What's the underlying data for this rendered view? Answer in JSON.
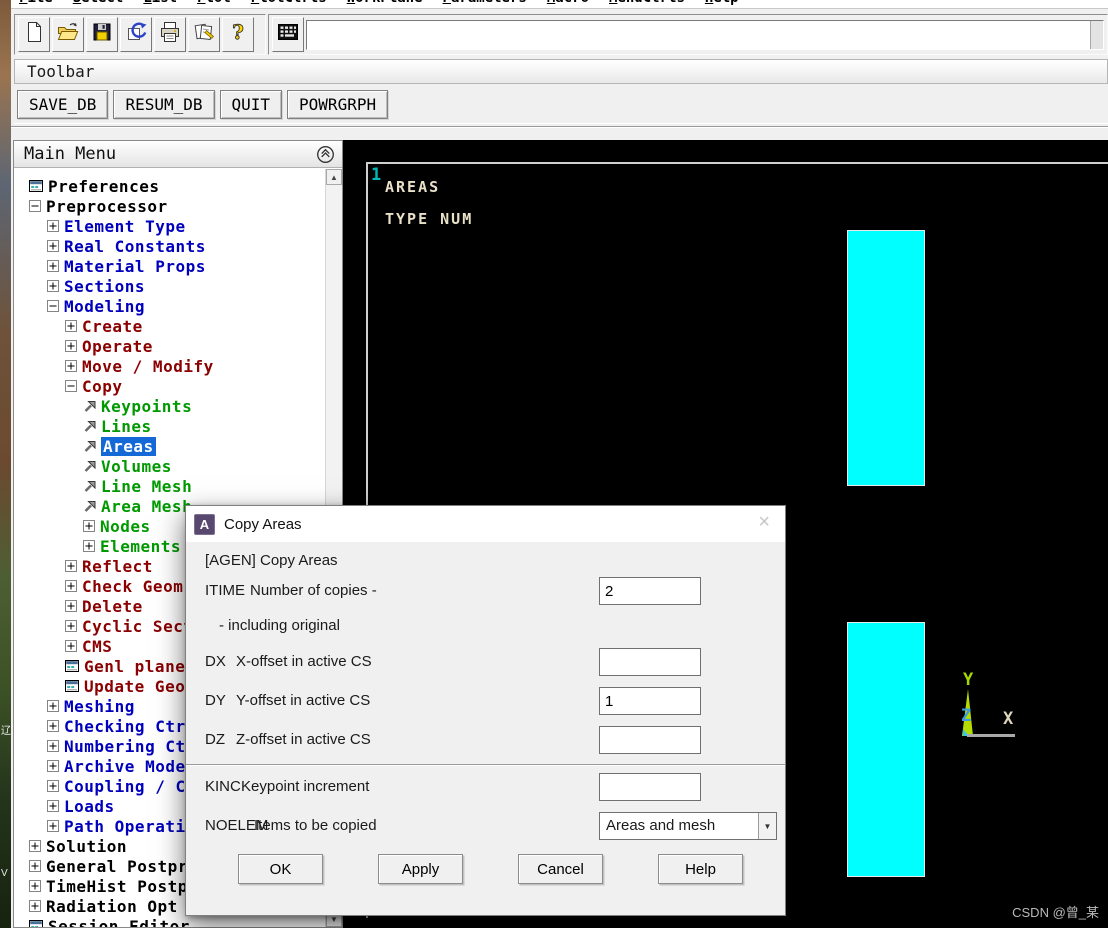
{
  "menu_bar": {
    "items": [
      "File",
      "Select",
      "List",
      "Plot",
      "PlotCtrls",
      "WorkPlane",
      "Parameters",
      "Macro",
      "MenuCtrls",
      "Help"
    ]
  },
  "quick_toolbar": {
    "icon_buttons": [
      "new-file",
      "open-folder",
      "save-db",
      "refresh-plot",
      "print",
      "report-generator",
      "help"
    ],
    "input_icon": "keypad",
    "command_input": {
      "value": ""
    }
  },
  "toolbar_panel": {
    "title": "Toolbar",
    "buttons": [
      "SAVE_DB",
      "RESUM_DB",
      "QUIT",
      "POWRGRPH"
    ]
  },
  "main_menu": {
    "title": "Main Menu",
    "collapse_icon": "chevron-up-circle",
    "items": [
      {
        "label": "Preferences",
        "level": 0,
        "icon": "dialog",
        "color": "black"
      },
      {
        "label": "Preprocessor",
        "level": 0,
        "icon": "minus",
        "color": "black"
      },
      {
        "label": "Element Type",
        "level": 1,
        "icon": "plus",
        "color": "blue"
      },
      {
        "label": "Real Constants",
        "level": 1,
        "icon": "plus",
        "color": "blue"
      },
      {
        "label": "Material Props",
        "level": 1,
        "icon": "plus",
        "color": "blue"
      },
      {
        "label": "Sections",
        "level": 1,
        "icon": "plus",
        "color": "blue"
      },
      {
        "label": "Modeling",
        "level": 1,
        "icon": "minus",
        "color": "blue"
      },
      {
        "label": "Create",
        "level": 2,
        "icon": "plus",
        "color": "red"
      },
      {
        "label": "Operate",
        "level": 2,
        "icon": "plus",
        "color": "red"
      },
      {
        "label": "Move / Modify",
        "level": 2,
        "icon": "plus",
        "color": "red"
      },
      {
        "label": "Copy",
        "level": 2,
        "icon": "minus",
        "color": "red"
      },
      {
        "label": "Keypoints",
        "level": 3,
        "icon": "arrow",
        "color": "green"
      },
      {
        "label": "Lines",
        "level": 3,
        "icon": "arrow",
        "color": "green"
      },
      {
        "label": "Areas",
        "level": 3,
        "icon": "arrow",
        "color": "green",
        "selected": true
      },
      {
        "label": "Volumes",
        "level": 3,
        "icon": "arrow",
        "color": "green"
      },
      {
        "label": "Line Mesh",
        "level": 3,
        "icon": "arrow",
        "color": "green"
      },
      {
        "label": "Area Mesh",
        "level": 3,
        "icon": "arrow",
        "color": "green"
      },
      {
        "label": "Nodes",
        "level": 3,
        "icon": "plus",
        "color": "green"
      },
      {
        "label": "Elements",
        "level": 3,
        "icon": "plus",
        "color": "green"
      },
      {
        "label": "Reflect",
        "level": 2,
        "icon": "plus",
        "color": "red"
      },
      {
        "label": "Check Geom",
        "level": 2,
        "icon": "plus",
        "color": "red"
      },
      {
        "label": "Delete",
        "level": 2,
        "icon": "plus",
        "color": "red"
      },
      {
        "label": "Cyclic Sector",
        "level": 2,
        "icon": "plus",
        "color": "red"
      },
      {
        "label": "CMS",
        "level": 2,
        "icon": "plus",
        "color": "red"
      },
      {
        "label": "Genl plane strn",
        "level": 2,
        "icon": "dialog",
        "color": "red"
      },
      {
        "label": "Update Geom",
        "level": 2,
        "icon": "dialog",
        "color": "red"
      },
      {
        "label": "Meshing",
        "level": 1,
        "icon": "plus",
        "color": "blue"
      },
      {
        "label": "Checking Ctrls",
        "level": 1,
        "icon": "plus",
        "color": "blue"
      },
      {
        "label": "Numbering Ctrls",
        "level": 1,
        "icon": "plus",
        "color": "blue"
      },
      {
        "label": "Archive Model",
        "level": 1,
        "icon": "plus",
        "color": "blue"
      },
      {
        "label": "Coupling / Ceqn",
        "level": 1,
        "icon": "plus",
        "color": "blue"
      },
      {
        "label": "Loads",
        "level": 1,
        "icon": "plus",
        "color": "blue"
      },
      {
        "label": "Path Operations",
        "level": 1,
        "icon": "plus",
        "color": "blue"
      },
      {
        "label": "Solution",
        "level": 0,
        "icon": "plus",
        "color": "black"
      },
      {
        "label": "General Postproc",
        "level": 0,
        "icon": "plus",
        "color": "black"
      },
      {
        "label": "TimeHist Postpro",
        "level": 0,
        "icon": "plus",
        "color": "black"
      },
      {
        "label": "Radiation Opt",
        "level": 0,
        "icon": "plus",
        "color": "black"
      },
      {
        "label": "Session Editor",
        "level": 0,
        "icon": "dialog",
        "color": "black"
      }
    ]
  },
  "graphics": {
    "window_id": "1",
    "annotations": [
      "AREAS",
      "TYPE NUM"
    ],
    "triad": {
      "x": "X",
      "y": "Y",
      "z": "Z"
    },
    "watermark": "CSDN @曾_某"
  },
  "dialog": {
    "title": "Copy Areas",
    "icon_letter": "A",
    "command": "[AGEN]  Copy Areas",
    "fields": [
      {
        "code": "ITIME",
        "label": "Number of copies -",
        "value": "2",
        "type": "input"
      },
      {
        "code": "",
        "label": "- including original",
        "value": "",
        "type": "note"
      },
      {
        "code": "DX",
        "label": "X-offset in active CS",
        "value": "",
        "type": "input"
      },
      {
        "code": "DY",
        "label": "Y-offset in active CS",
        "value": "1",
        "type": "input"
      },
      {
        "code": "DZ",
        "label": "Z-offset in active CS",
        "value": "",
        "type": "input"
      },
      {
        "code": "KINC",
        "label": "Keypoint increment",
        "value": "",
        "type": "input"
      },
      {
        "code": "NOELEM",
        "label": "Items to be copied",
        "value": "Areas and mesh",
        "type": "select"
      }
    ],
    "buttons": [
      "OK",
      "Apply",
      "Cancel",
      "Help"
    ]
  },
  "colors": {
    "tree_black": "#000000",
    "tree_blue": "#0000bd",
    "tree_red": "#8b0000",
    "tree_green": "#009a00",
    "selection": "#1569d6",
    "area_fill": "#00ffff",
    "annotation_text": "#e9e0c8",
    "window_id_text": "#00b8b8",
    "triad_y": "#a6d800",
    "triad_z": "#3b9ae1",
    "triad_x": "#ddd5bd",
    "watermark": "#b9b9b9",
    "dialog_icon_bg": "#58476e"
  }
}
